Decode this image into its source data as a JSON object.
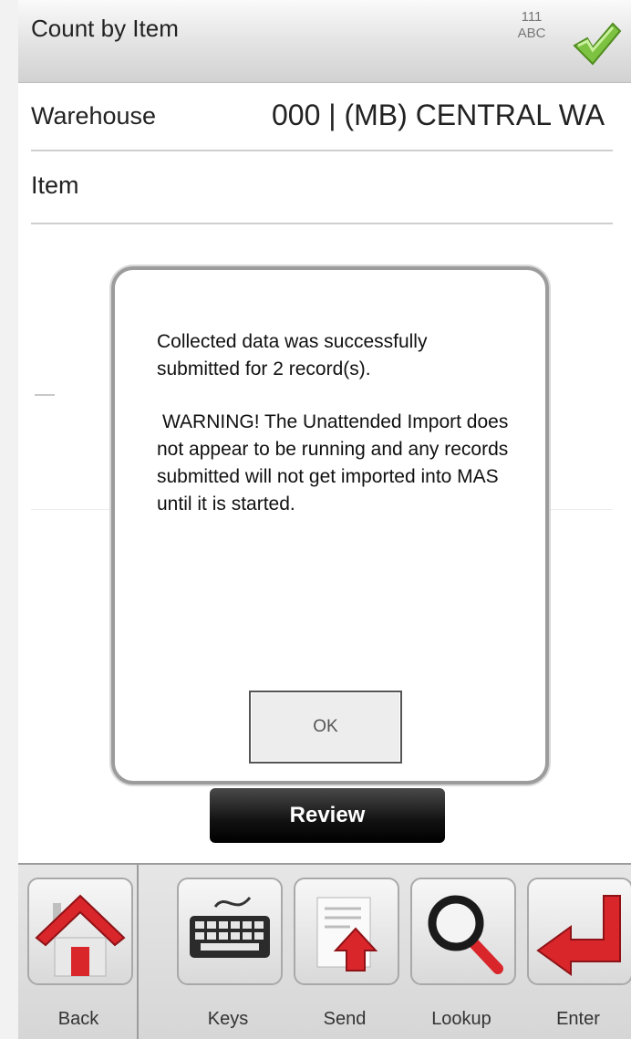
{
  "header": {
    "title": "Count by Item",
    "mode_top": "111",
    "mode_bottom": "ABC",
    "check_icon": "green-checkmark-icon",
    "check_color": "#7dc241"
  },
  "form": {
    "warehouse_label": "Warehouse",
    "warehouse_value": "000 | (MB) CENTRAL WA",
    "item_label": "Item"
  },
  "dialog": {
    "message": "Collected data was successfully submitted for 2 record(s).",
    "warning": "WARNING!  The Unattended Import does not appear to be running and any records submitted will not get imported into MAS until it is started.",
    "ok_label": "OK"
  },
  "review_label": "Review",
  "toolbar": {
    "items": [
      {
        "label": "Back",
        "icon": "home-icon"
      },
      {
        "label": "Keys",
        "icon": "keyboard-icon"
      },
      {
        "label": "Send",
        "icon": "send-icon"
      },
      {
        "label": "Lookup",
        "icon": "magnifier-icon"
      },
      {
        "label": "Enter",
        "icon": "enter-arrow-icon"
      }
    ]
  },
  "colors": {
    "accent_red": "#d9262b",
    "header_bg": "#dcdcdc",
    "review_bg": "#111111"
  }
}
